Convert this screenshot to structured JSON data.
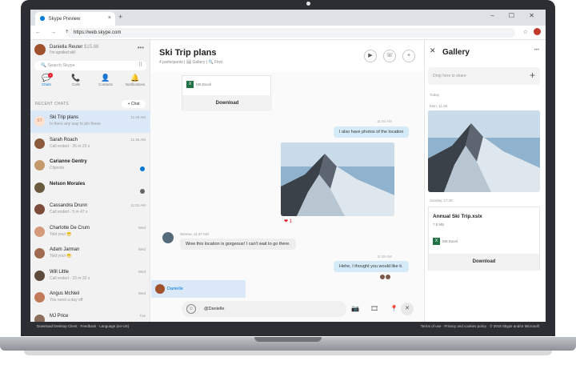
{
  "browser": {
    "tab_title": "Skype Preview",
    "tab_close": "×",
    "new_tab": "+",
    "window_controls": "– ☐ ✕",
    "nav_buttons": "← → ↻",
    "url": "https://web.skype.com"
  },
  "sidebar": {
    "profile_name": "Daniella Reuter",
    "profile_amount": "$15.68",
    "profile_status": "I'm spoiled ski!",
    "more": "•••",
    "search_placeholder": "Search Skype",
    "dialpad": "⠿",
    "nav": [
      {
        "label": "Chats",
        "icon": "💬",
        "badge": "1"
      },
      {
        "label": "Calls",
        "icon": "📞"
      },
      {
        "label": "Contacts",
        "icon": "👤"
      },
      {
        "label": "Notifications",
        "icon": "🔔"
      }
    ],
    "recent_label": "RECENT CHATS",
    "chat_button": "+ Chat",
    "chats": [
      {
        "name": "Ski Trip plans",
        "preview": "Is there any way to pin these",
        "time": "11:48 AM",
        "initials": "ST"
      },
      {
        "name": "Sarah Roach",
        "preview": "Call ended - 26 m 23 s",
        "time": "11:36 AM"
      },
      {
        "name": "Carianne Gentry",
        "preview": "Clipnote",
        "time": ""
      },
      {
        "name": "Nelson Morales",
        "preview": "",
        "time": ""
      },
      {
        "name": "Cassandra Drunn",
        "preview": "Call ended - 5 m 47 s",
        "time": "11:01 AM"
      },
      {
        "name": "Charlotte De Crum",
        "preview": "Told you! 😁",
        "time": "Wed"
      },
      {
        "name": "Adam Jarman",
        "preview": "Told you! 😁",
        "time": "Wed"
      },
      {
        "name": "Will Little",
        "preview": "Call ended - 10 m 32 s",
        "time": "Wed"
      },
      {
        "name": "Angus McNeil",
        "preview": "You need a day off",
        "time": "Wed"
      },
      {
        "name": "MJ Price",
        "preview": "",
        "time": "Tue"
      }
    ]
  },
  "conversation": {
    "title": "Ski Trip plans",
    "meta": "4 participants | 🖼 Gallery | 🔍 Find",
    "file_type": "MS Excel",
    "download": "Download",
    "messages": [
      {
        "time": "11:45 AM",
        "text": "I also have photos of the location"
      },
      {
        "time": "",
        "text": "Wow this location is gorgeous! I can't wait to go there."
      },
      {
        "time": "11:48 AM",
        "text": "Hehe, I thought you would like it."
      }
    ],
    "incoming_meta": "Serena, 11:47 AM",
    "reaction": "❤ 1",
    "mention_name": "Danielle",
    "composer_text": "@Danielle",
    "composer_icons": "📷 🎞 📍",
    "composer_close": "✕"
  },
  "gallery": {
    "close": "✕",
    "title": "Gallery",
    "more": "•••",
    "drop_placeholder": "Drop here to share",
    "add": "+",
    "section_today": "Today",
    "photo_time": "Mon, 11:35",
    "file_time": "Sunday, 17:20",
    "file_name": "Annual Ski Trip.xslx",
    "file_size": "7.8 MB",
    "file_type": "MS Excel",
    "download": "Download"
  },
  "footer": {
    "left": "Download Desktop Client   ·   Feedback   ·   Language (en-US)",
    "right": "Terms of use   ·   Privacy and cookies policy   ·   © 2018 Skype and/or Microsoft"
  },
  "colors": {
    "accent": "#0078d4",
    "bubble_out": "#d6ebfa",
    "bezel": "#2d2e33"
  }
}
